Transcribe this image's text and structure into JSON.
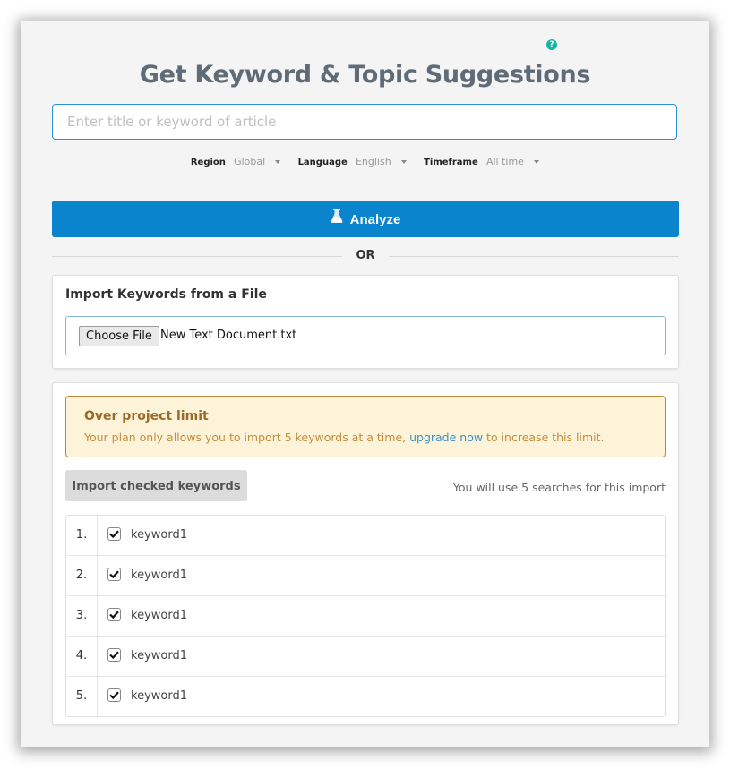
{
  "header": {
    "title": "Get Keyword & Topic Suggestions",
    "help_icon": "question-circle-icon",
    "help_glyph": "?"
  },
  "search": {
    "placeholder": "Enter title or keyword of article",
    "value": ""
  },
  "filters": [
    {
      "label": "Region",
      "value": "Global"
    },
    {
      "label": "Language",
      "value": "English"
    },
    {
      "label": "Timeframe",
      "value": "All time"
    }
  ],
  "analyze": {
    "label": "Analyze",
    "icon": "flask-icon",
    "color": "#0a84cc"
  },
  "divider": {
    "label": "OR"
  },
  "import_file": {
    "title": "Import Keywords from a File",
    "button_label": "Choose File",
    "file_name": "New Text Document.txt"
  },
  "alert": {
    "title": "Over project limit",
    "text_before": "Your plan only allows you to import 5 keywords at a time, ",
    "link_text": "upgrade now",
    "text_after": " to increase this limit."
  },
  "import_checked": {
    "button_label": "Import checked keywords",
    "note": "You will use 5 searches for this import"
  },
  "keywords": [
    {
      "number": "1.",
      "label": "keyword1",
      "checked": true
    },
    {
      "number": "2.",
      "label": "keyword1",
      "checked": true
    },
    {
      "number": "3.",
      "label": "keyword1",
      "checked": true
    },
    {
      "number": "4.",
      "label": "keyword1",
      "checked": true
    },
    {
      "number": "5.",
      "label": "keyword1",
      "checked": true
    }
  ]
}
